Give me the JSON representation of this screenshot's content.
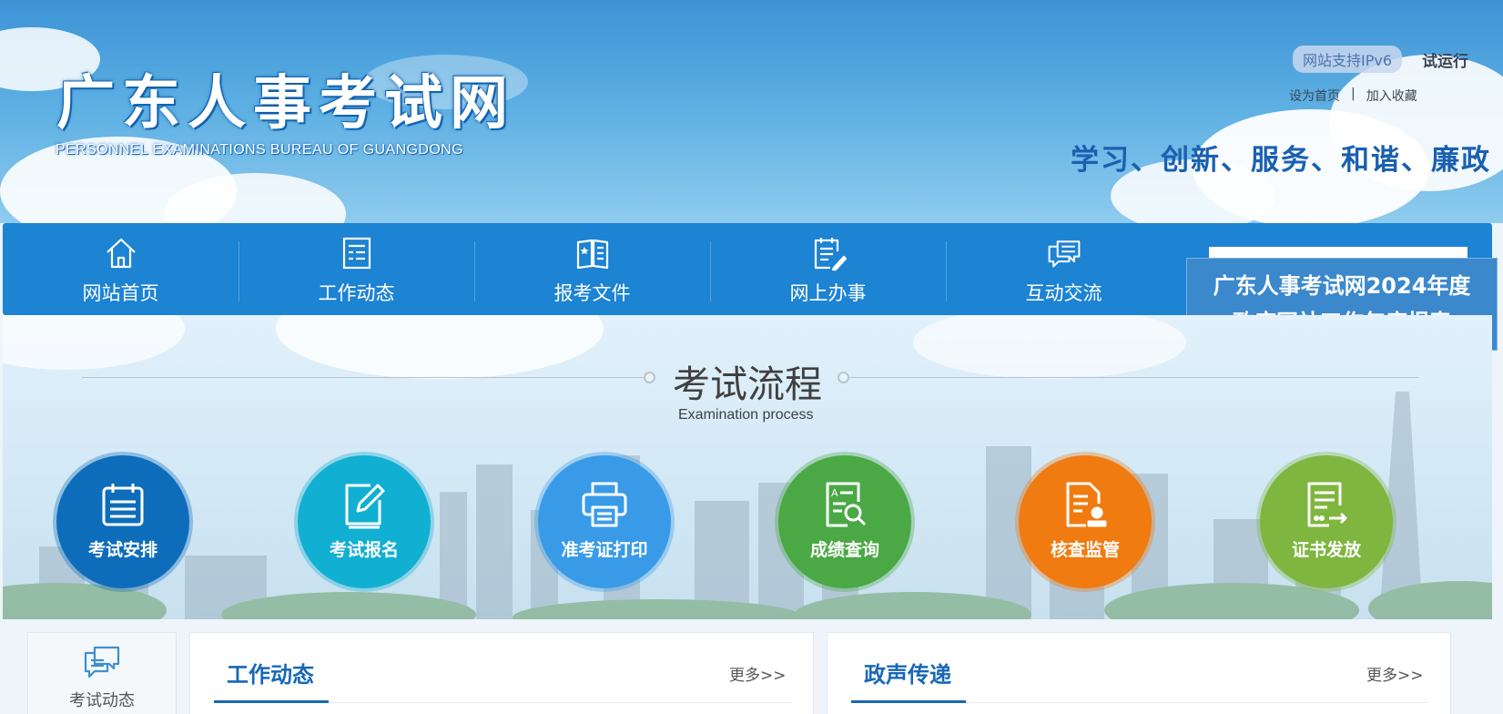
{
  "header": {
    "site_name": "广东人事考试网",
    "site_name_en": "PERSONNEL EXAMINATIONS BUREAU OF GUANGDONG",
    "ipv6_badge": "网站支持IPv6",
    "trial_label": "试运行",
    "set_homepage": "设为首页",
    "link_separator": "|",
    "add_favorite": "加入收藏",
    "slogan": "学习、创新、服务、和谐、廉政"
  },
  "nav": {
    "items": [
      {
        "label": "网站首页",
        "icon": "home-icon"
      },
      {
        "label": "工作动态",
        "icon": "news-list-icon"
      },
      {
        "label": "报考文件",
        "icon": "open-book-icon"
      },
      {
        "label": "网上办事",
        "icon": "clipboard-edit-icon"
      },
      {
        "label": "互动交流",
        "icon": "chat-bubbles-icon"
      }
    ],
    "search_value": ""
  },
  "report_banner": {
    "line1": "广东人事考试网2024年度",
    "line2": "政府网站工作年度报表"
  },
  "process": {
    "title": "考试流程",
    "subtitle": "Examination process",
    "steps": [
      {
        "label": "考试安排",
        "icon": "calendar-icon",
        "color": "#0f6dbb"
      },
      {
        "label": "考试报名",
        "icon": "edit-form-icon",
        "color": "#12b0d2"
      },
      {
        "label": "准考证打印",
        "icon": "printer-icon",
        "color": "#3a9be9"
      },
      {
        "label": "成绩查询",
        "icon": "search-document-icon",
        "color": "#4aa845"
      },
      {
        "label": "核查监管",
        "icon": "document-stamp-icon",
        "color": "#f07c12"
      },
      {
        "label": "证书发放",
        "icon": "certificate-issue-icon",
        "color": "#7eb63f"
      }
    ]
  },
  "sidebar": {
    "label": "考试动态",
    "icon": "chat-icon"
  },
  "panels": [
    {
      "title": "工作动态",
      "more": "更多>>"
    },
    {
      "title": "政声传递",
      "more": "更多>>"
    }
  ],
  "colors": {
    "nav_bg": "#1d83d3",
    "accent": "#1768b7",
    "banner_bg": "#3b88cd"
  }
}
